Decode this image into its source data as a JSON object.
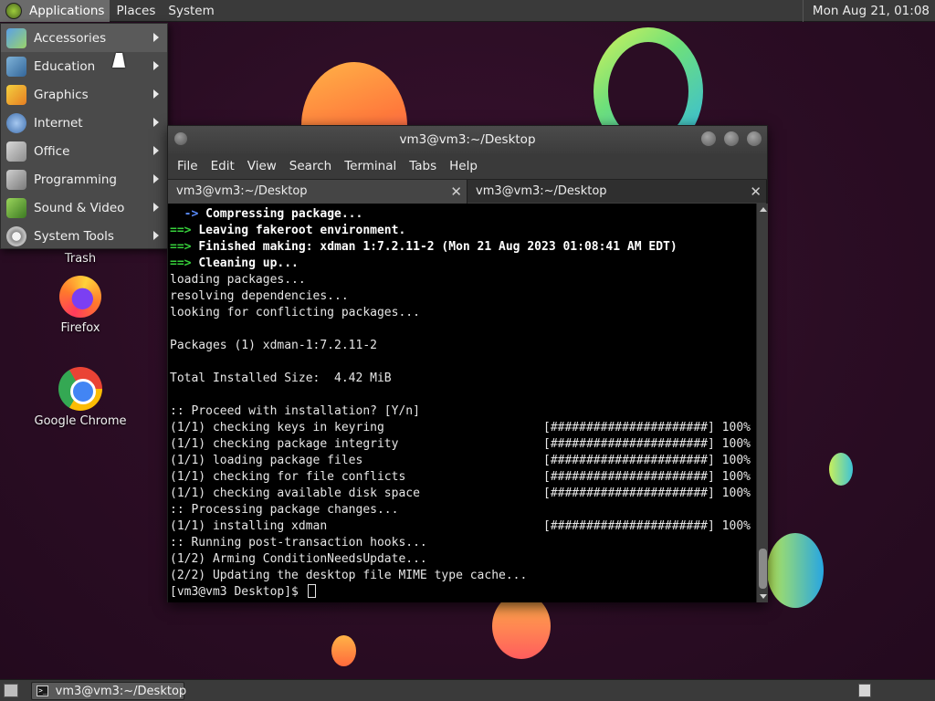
{
  "top_panel": {
    "applications_label": "Applications",
    "places_label": "Places",
    "system_label": "System",
    "clock": "Mon Aug 21, 01:08"
  },
  "apps_menu": {
    "items": [
      {
        "label": "Accessories",
        "icon": "accessories-icon"
      },
      {
        "label": "Education",
        "icon": "education-icon"
      },
      {
        "label": "Graphics",
        "icon": "graphics-icon"
      },
      {
        "label": "Internet",
        "icon": "internet-icon"
      },
      {
        "label": "Office",
        "icon": "office-icon"
      },
      {
        "label": "Programming",
        "icon": "programming-icon"
      },
      {
        "label": "Sound & Video",
        "icon": "sound-video-icon"
      },
      {
        "label": "System Tools",
        "icon": "system-tools-icon"
      }
    ]
  },
  "desktop": {
    "trash_label": "Trash",
    "firefox_label": "Firefox",
    "chrome_label": "Google Chrome"
  },
  "terminal": {
    "title": "vm3@vm3:~/Desktop",
    "menu": [
      "File",
      "Edit",
      "View",
      "Search",
      "Terminal",
      "Tabs",
      "Help"
    ],
    "tabs": [
      {
        "label": "vm3@vm3:~/Desktop",
        "active": true
      },
      {
        "label": "vm3@vm3:~/Desktop",
        "active": false
      }
    ],
    "lines": [
      {
        "prefix": "  -> ",
        "text": "Compressing package...",
        "bold": true
      },
      {
        "prefix": "==> ",
        "text": "Leaving fakeroot environment.",
        "bold": true
      },
      {
        "prefix": "==> ",
        "text": "Finished making: xdman 1:7.2.11-2 (Mon 21 Aug 2023 01:08:41 AM EDT)",
        "bold": true
      },
      {
        "prefix": "==> ",
        "text": "Cleaning up...",
        "bold": true
      },
      {
        "text": "loading packages..."
      },
      {
        "text": "resolving dependencies..."
      },
      {
        "text": "looking for conflicting packages..."
      },
      {
        "text": ""
      },
      {
        "text": "Packages (1) xdman-1:7.2.11-2"
      },
      {
        "text": ""
      },
      {
        "text": "Total Installed Size:  4.42 MiB"
      },
      {
        "text": ""
      },
      {
        "text": ":: Proceed with installation? [Y/n]"
      },
      {
        "text": "(1/1) checking keys in keyring",
        "progress": "[######################] 100%"
      },
      {
        "text": "(1/1) checking package integrity",
        "progress": "[######################] 100%"
      },
      {
        "text": "(1/1) loading package files",
        "progress": "[######################] 100%"
      },
      {
        "text": "(1/1) checking for file conflicts",
        "progress": "[######################] 100%"
      },
      {
        "text": "(1/1) checking available disk space",
        "progress": "[######################] 100%"
      },
      {
        "text": ":: Processing package changes..."
      },
      {
        "text": "(1/1) installing xdman",
        "progress": "[######################] 100%"
      },
      {
        "text": ":: Running post-transaction hooks..."
      },
      {
        "text": "(1/2) Arming ConditionNeedsUpdate..."
      },
      {
        "text": "(2/2) Updating the desktop file MIME type cache..."
      },
      {
        "text": "[vm3@vm3 Desktop]$ ",
        "prompt": true
      }
    ]
  },
  "taskbar": {
    "task_label": "vm3@vm3:~/Desktop"
  },
  "colors": {
    "prompt_arrow": "#36d13b",
    "panel_bg": "#3a3a3a",
    "menu_bg": "#4a4a4a",
    "desktop_bg": "#2b0d24"
  }
}
